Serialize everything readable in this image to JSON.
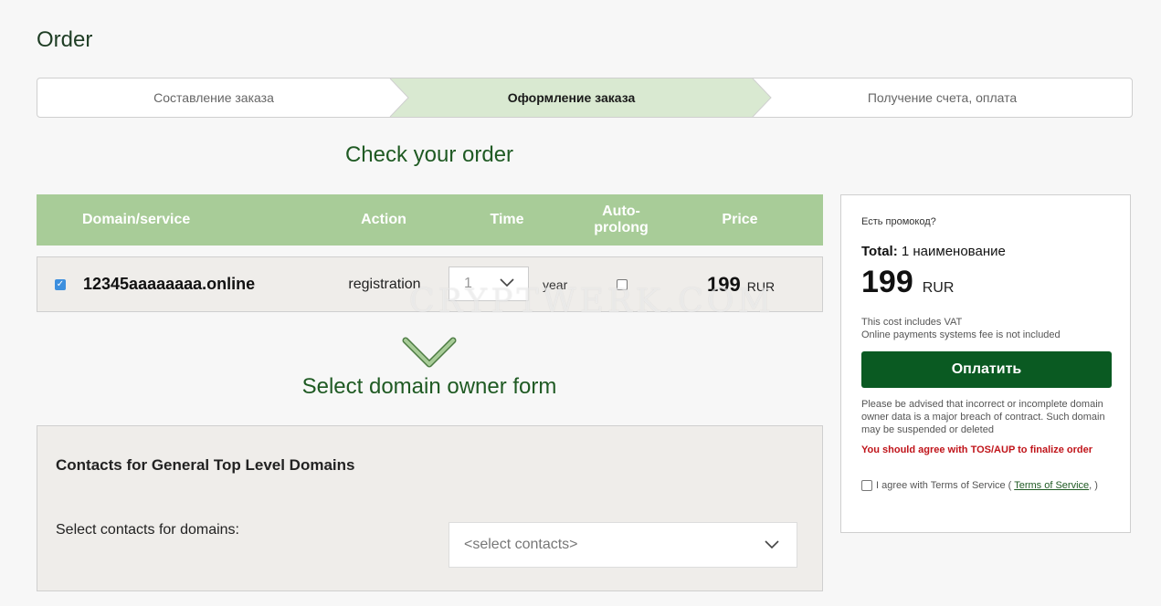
{
  "page_title": "Order",
  "steps": [
    {
      "label": "Составление заказа",
      "active": false
    },
    {
      "label": "Оформление заказа",
      "active": true
    },
    {
      "label": "Получение счета, оплата",
      "active": false
    }
  ],
  "check_heading": "Check your order",
  "table": {
    "headers": {
      "domain": "Domain/service",
      "action": "Action",
      "time": "Time",
      "autoprolong": "Auto-\nprolong",
      "price": "Price"
    },
    "row": {
      "checked": true,
      "domain": "12345aaaaaaaa.online",
      "action": "registration",
      "time_value": "1",
      "time_unit": "year",
      "autoprolong": false,
      "price": "199",
      "currency": "RUR"
    }
  },
  "owner_heading": "Select domain owner form",
  "contacts": {
    "title": "Contacts for General Top Level Domains",
    "label": "Select contacts for domains:",
    "placeholder": "<select contacts>"
  },
  "summary": {
    "promo": "Есть промокод?",
    "total_label": "Total:",
    "total_items": "1 наименование",
    "price": "199",
    "currency": "RUR",
    "vat_note": "This cost includes VAT",
    "fee_note": "Online payments systems fee is not included",
    "pay_button": "Оплатить",
    "advice": "Please be advised that incorrect or incomplete domain owner data is a major breach of contract. Such domain may be suspended or deleted",
    "warning": "You should agree with TOS/AUP to finalize order",
    "agree_text": "I agree with Terms of Service (",
    "tos_link": "Terms of Service",
    "agree_end": ", )"
  },
  "watermark": "CRYPTWERK.COM",
  "colors": {
    "accent_green": "#0a5a22",
    "header_green": "#a8cc98",
    "warning_red": "#c0141a"
  }
}
